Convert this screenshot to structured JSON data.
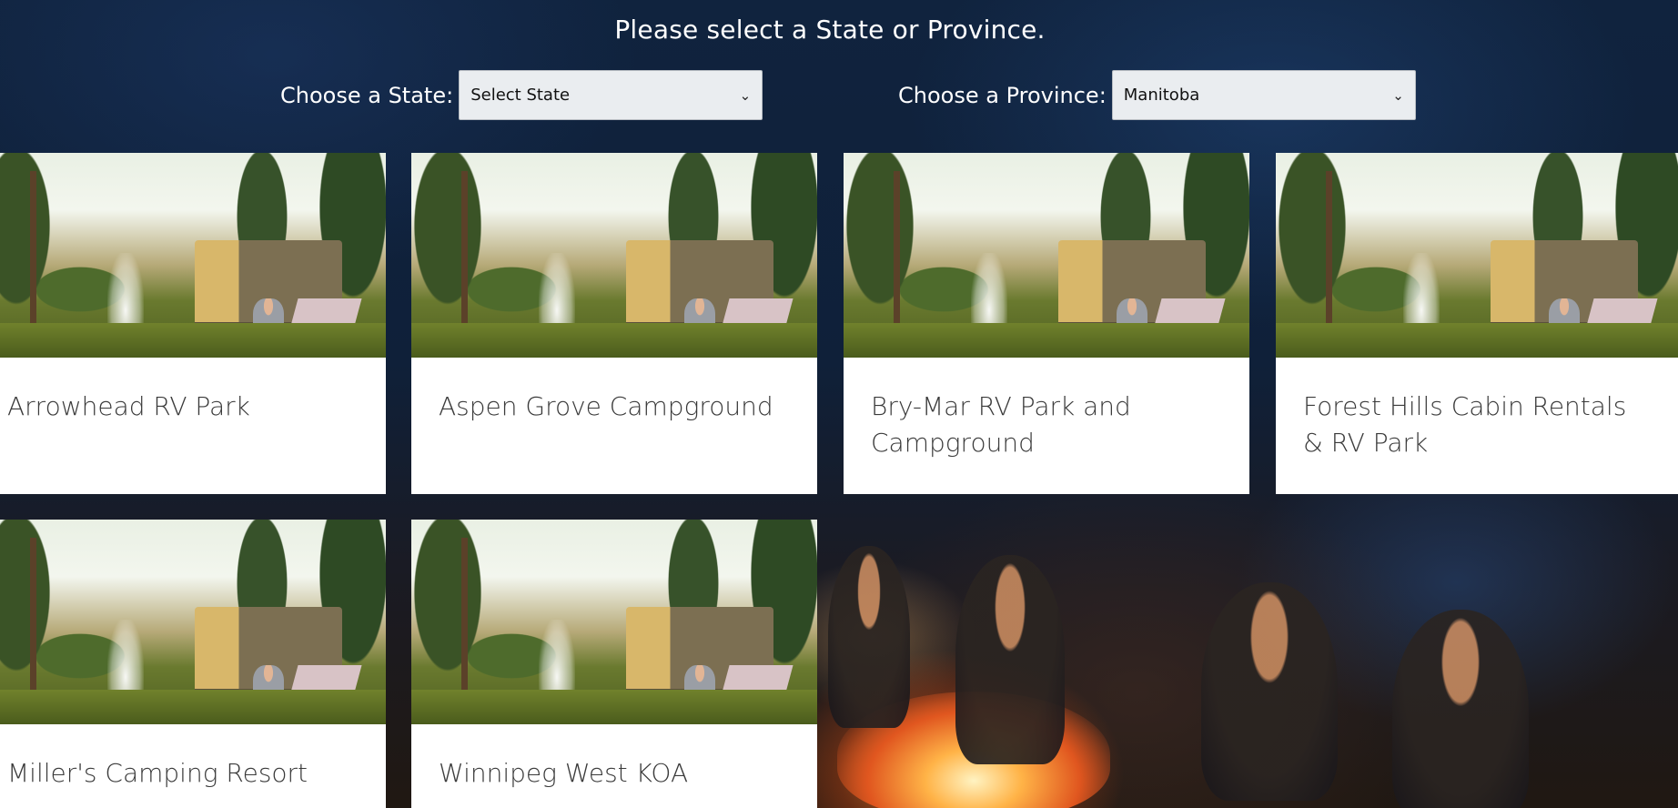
{
  "header": {
    "title": "Please select a State or Province.",
    "state_label": "Choose a State:",
    "state_selected": "Select State",
    "province_label": "Choose a Province:",
    "province_selected": "Manitoba"
  },
  "campgrounds": [
    {
      "name": "Arrowhead RV Park"
    },
    {
      "name": "Aspen Grove Campground"
    },
    {
      "name": "Bry-Mar RV Park and Campground"
    },
    {
      "name": "Forest Hills Cabin Rentals & RV Park"
    },
    {
      "name": "Miller's Camping Resort"
    },
    {
      "name": "Winnipeg West KOA"
    }
  ],
  "colors": {
    "header_text": "#ffffff",
    "card_background": "#ffffff",
    "card_text": "#3a3a3a",
    "select_background": "#eaedf0"
  },
  "icons": {
    "select_arrow": "chevron-down-icon"
  }
}
